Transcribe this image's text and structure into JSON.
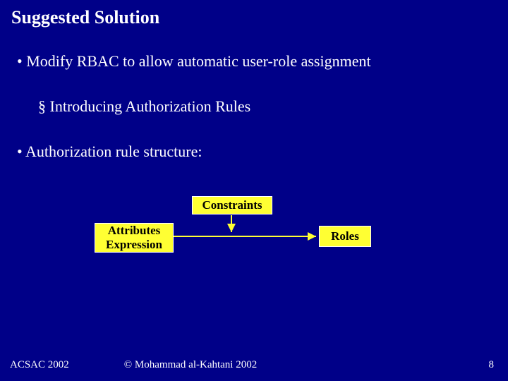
{
  "title": "Suggested Solution",
  "bullets": {
    "item1": "Modify RBAC to allow automatic user-role assignment",
    "sub1": "Introducing Authorization Rules",
    "item2": "Authorization rule structure:"
  },
  "boxes": {
    "constraints": "Constraints",
    "attributes_line1": "Attributes",
    "attributes_line2": "Expression",
    "roles": "Roles"
  },
  "footer": {
    "left": "ACSAC 2002",
    "center": "© Mohammad al-Kahtani 2002",
    "right": "8"
  }
}
